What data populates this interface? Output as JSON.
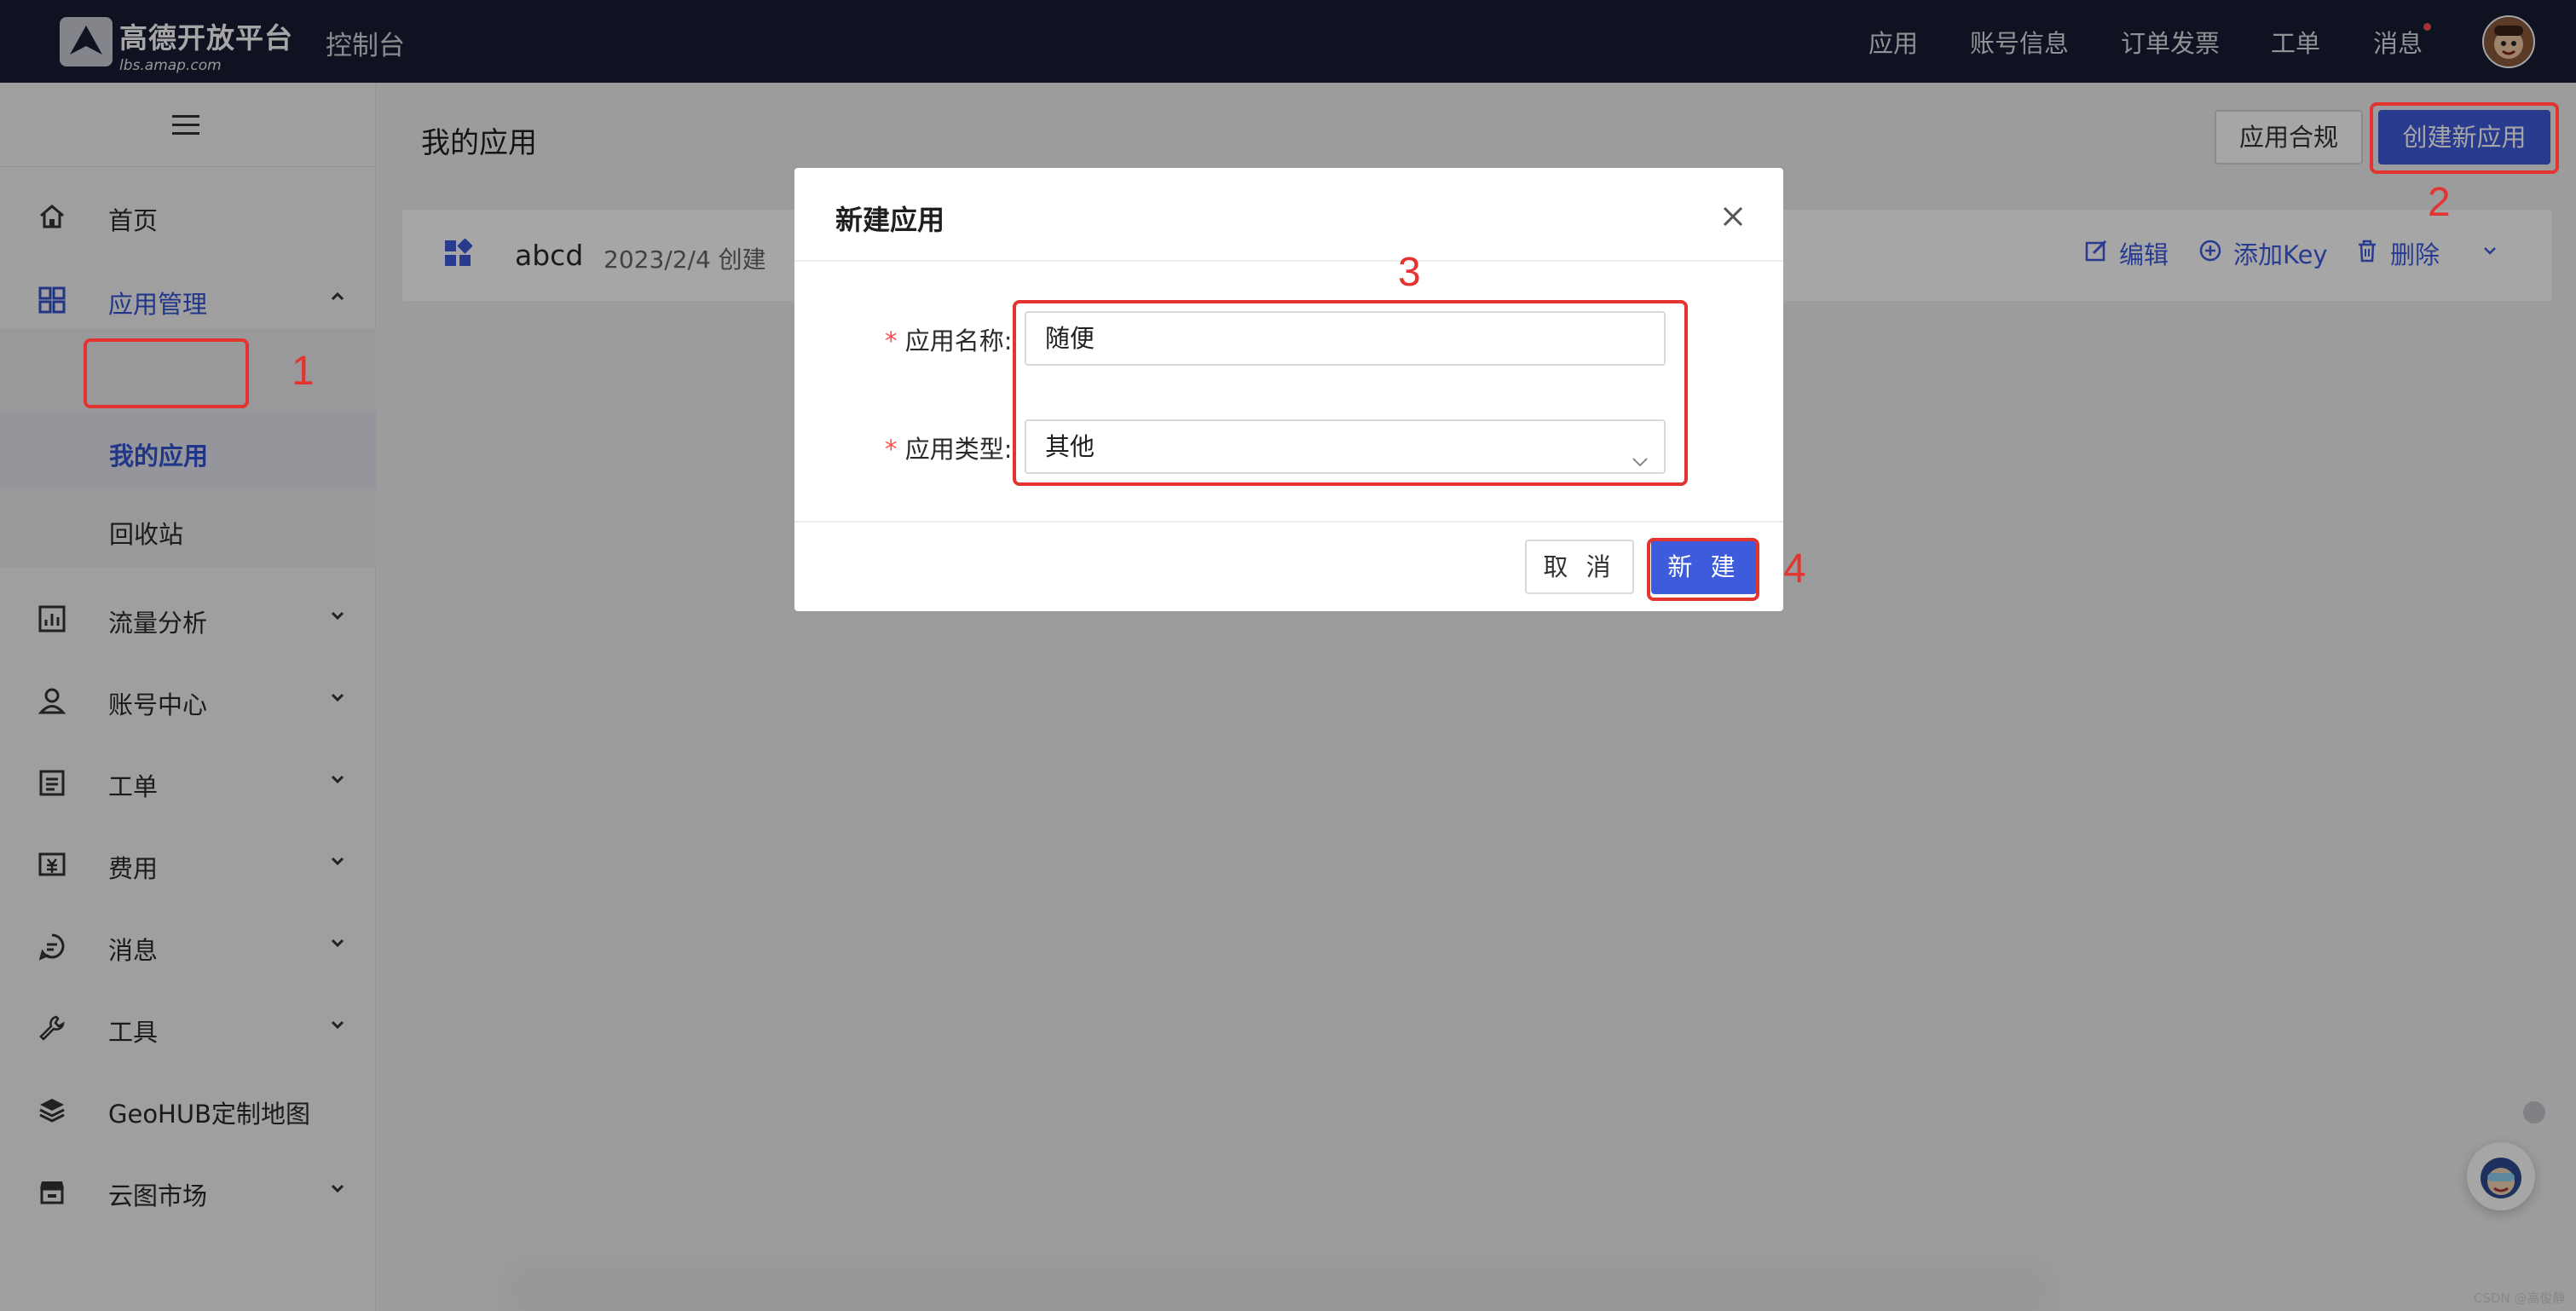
{
  "header": {
    "brand_name": "高德开放平台",
    "brand_url": "lbs.amap.com",
    "console_title": "控制台",
    "nav": [
      "应用",
      "账号信息",
      "订单发票",
      "工单",
      "消息"
    ]
  },
  "sidebar": {
    "items": [
      {
        "label": "首页",
        "icon": "home-icon"
      },
      {
        "label": "应用管理",
        "icon": "apps-icon"
      },
      {
        "label": "流量分析",
        "icon": "chart-icon"
      },
      {
        "label": "账号中心",
        "icon": "user-icon"
      },
      {
        "label": "工单",
        "icon": "ticket-icon"
      },
      {
        "label": "费用",
        "icon": "fee-icon"
      },
      {
        "label": "消息",
        "icon": "message-icon"
      },
      {
        "label": "工具",
        "icon": "wrench-icon"
      },
      {
        "label": "GeoHUB定制地图",
        "icon": "layers-icon"
      },
      {
        "label": "云图市场",
        "icon": "store-icon"
      }
    ],
    "subitems": [
      {
        "label": "我的应用"
      },
      {
        "label": "回收站"
      }
    ]
  },
  "main": {
    "page_title": "我的应用",
    "compliance_button": "应用合规",
    "create_button": "创建新应用",
    "app_card": {
      "name": "abcd",
      "created": "2023/2/4 创建",
      "edit": "编辑",
      "add_key": "添加Key",
      "delete": "删除"
    }
  },
  "modal": {
    "title": "新建应用",
    "name_label": "应用名称:",
    "name_value": "随便",
    "type_label": "应用类型:",
    "type_value": "其他",
    "required_mark": "*",
    "cancel": "取 消",
    "ok": "新 建"
  },
  "annotations": [
    "1",
    "2",
    "3",
    "4"
  ],
  "watermark": "CSDN @高俊静",
  "colors": {
    "topbar": "#161d33",
    "primary": "#3e5bdb",
    "annotation": "#e3342f",
    "required": "#ff4d4f"
  }
}
